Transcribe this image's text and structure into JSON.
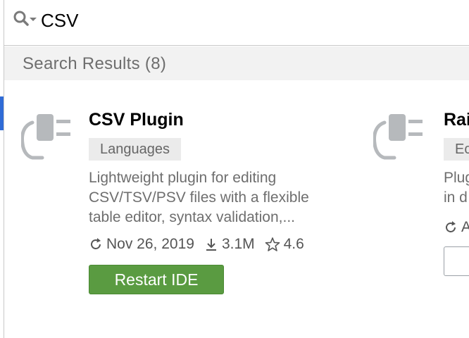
{
  "search": {
    "value": "CSV",
    "placeholder": ""
  },
  "results": {
    "title": "Search Results (8)"
  },
  "plugins": [
    {
      "name": "CSV Plugin",
      "tag": "Languages",
      "description_lines": [
        "Lightweight plugin for editing",
        "CSV/TSV/PSV files with a flexible",
        "table editor, syntax validation,..."
      ],
      "date": "Nov 26, 2019",
      "downloads": "3.1M",
      "rating": "4.6",
      "action_label": "Restart IDE"
    },
    {
      "name": "Rai",
      "tag": "Ec",
      "description_lines": [
        "Plug",
        "in d"
      ],
      "date": "A"
    }
  ],
  "colors": {
    "accent_blue": "#2f6bd6",
    "restart_green": "#5a9b41",
    "icon_gray": "#b6b9bc"
  },
  "icons": {
    "search": "search-dropdown-icon",
    "plugin": "plug-icon",
    "updated": "refresh-icon",
    "downloads": "download-icon",
    "rating": "star-icon"
  }
}
